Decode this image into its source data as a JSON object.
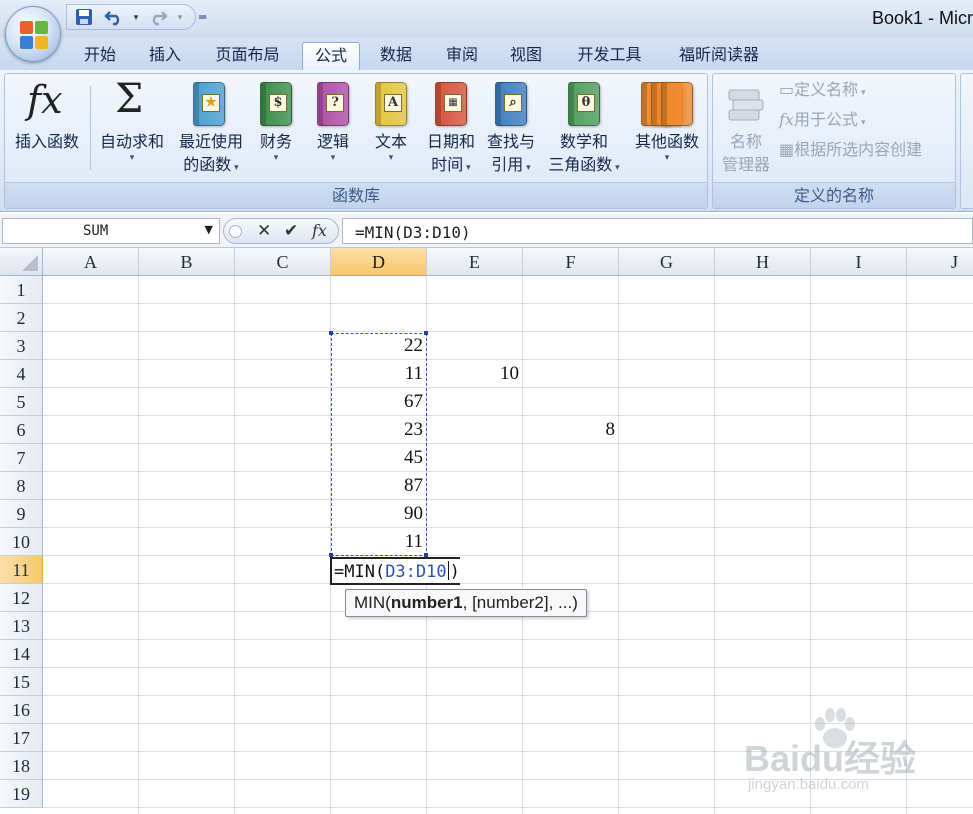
{
  "window": {
    "title": "Book1 - Micr"
  },
  "qat": {
    "save_icon": "save-icon",
    "undo_icon": "undo-icon",
    "redo_icon": "redo-icon"
  },
  "tabs": [
    "开始",
    "插入",
    "页面布局",
    "公式",
    "数据",
    "审阅",
    "视图",
    "开发工具",
    "福昕阅读器"
  ],
  "active_tab": "公式",
  "ribbon": {
    "function_library": {
      "label": "函数库",
      "buttons": [
        {
          "line1": "插入函数",
          "line2": ""
        },
        {
          "line1": "自动求和",
          "line2": ""
        },
        {
          "line1": "最近使用",
          "line2": "的函数"
        },
        {
          "line1": "财务",
          "line2": ""
        },
        {
          "line1": "逻辑",
          "line2": ""
        },
        {
          "line1": "文本",
          "line2": ""
        },
        {
          "line1": "日期和",
          "line2": "时间"
        },
        {
          "line1": "查找与",
          "line2": "引用"
        },
        {
          "line1": "数学和",
          "line2": "三角函数"
        },
        {
          "line1": "其他函数",
          "line2": ""
        }
      ]
    },
    "defined_names": {
      "label": "定义的名称",
      "name_manager": {
        "line1": "名称",
        "line2": "管理器"
      },
      "define_name": "定义名称",
      "use_in_formula": "用于公式",
      "create_from_selection": "根据所选内容创建"
    },
    "colors": {
      "financial": "#3c8f4a",
      "logical": "#b14fa6",
      "text": "#e4c53c",
      "datetime": "#d9533a",
      "lookup": "#3f7fc0",
      "math": "#4f9f5c",
      "more": "#ef8a2d",
      "recent": "#4a9fd0"
    }
  },
  "formula_bar": {
    "name_box": "SUM",
    "formula": "=MIN(D3:D10)",
    "cancel_icon": "cancel-icon",
    "enter_icon": "check-icon",
    "fx_icon": "fx-icon"
  },
  "sheet": {
    "columns": [
      "A",
      "B",
      "C",
      "D",
      "E",
      "F",
      "G",
      "H",
      "I",
      "J"
    ],
    "rows": [
      "1",
      "2",
      "3",
      "4",
      "5",
      "6",
      "7",
      "8",
      "9",
      "10",
      "11",
      "12",
      "13",
      "14",
      "15",
      "16",
      "17",
      "18",
      "19"
    ],
    "selected_column": "D",
    "selected_row": "11",
    "cells": [
      {
        "ref": "D3",
        "value": "22"
      },
      {
        "ref": "D4",
        "value": "11"
      },
      {
        "ref": "E4",
        "value": "10"
      },
      {
        "ref": "D5",
        "value": "67"
      },
      {
        "ref": "D6",
        "value": "23"
      },
      {
        "ref": "F6",
        "value": "8"
      },
      {
        "ref": "D7",
        "value": "45"
      },
      {
        "ref": "D8",
        "value": "87"
      },
      {
        "ref": "D9",
        "value": "90"
      },
      {
        "ref": "D10",
        "value": "11"
      }
    ],
    "editing": {
      "prefix": "=MIN(",
      "range": "D3:D10",
      "suffix": ")"
    },
    "tooltip": {
      "fn": "MIN(",
      "arg1": "number1",
      "rest": ", [number2], ...)"
    }
  },
  "watermark": {
    "big": "Baidu经验",
    "small": "jingyan.baidu.com"
  }
}
